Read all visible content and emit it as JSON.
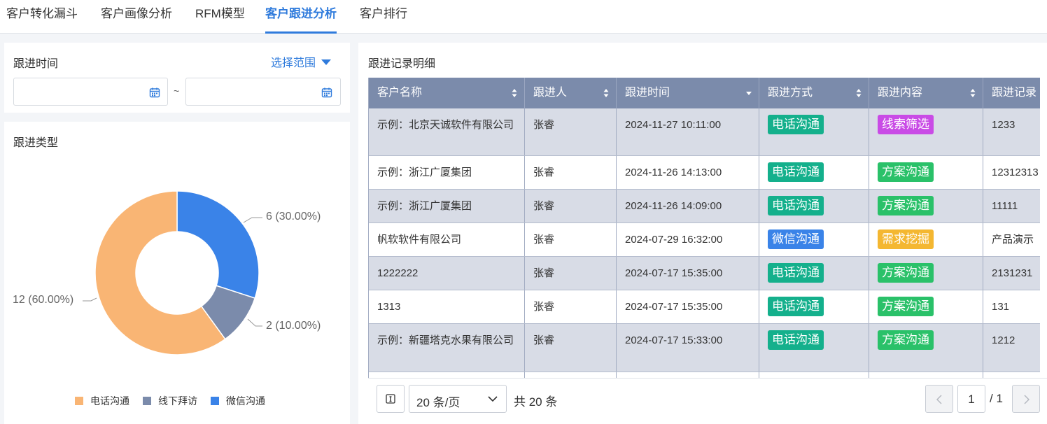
{
  "tabs": [
    {
      "label": "客户转化漏斗"
    },
    {
      "label": "客户画像分析"
    },
    {
      "label": "RFM模型"
    },
    {
      "label": "客户跟进分析"
    },
    {
      "label": "客户排行"
    }
  ],
  "filter": {
    "title": "跟进时间",
    "range_label": "选择范围",
    "start_value": "",
    "end_value": "",
    "separator": "~"
  },
  "type_chart": {
    "title": "跟进类型",
    "labels": {
      "phone": "12 (60.00%)",
      "offline": "2 (10.00%)",
      "wechat": "6 (30.00%)"
    },
    "legend": [
      "电话沟通",
      "线下拜访",
      "微信沟通"
    ]
  },
  "chart_data": {
    "type": "pie",
    "categories": [
      "电话沟通",
      "线下拜访",
      "微信沟通"
    ],
    "values": [
      12,
      2,
      6
    ],
    "percents": [
      60,
      10,
      30
    ],
    "colors": [
      "#f9b574",
      "#7b8bab",
      "#3a83e8"
    ],
    "donut": true,
    "legend_position": "bottom"
  },
  "records": {
    "title": "跟进记录明细",
    "columns": [
      "客户名称",
      "跟进人",
      "跟进时间",
      "跟进方式",
      "跟进内容",
      "跟进记录"
    ],
    "rows": [
      {
        "name": "示例：北京天诚软件有限公司",
        "owner": "张睿",
        "time": "2024-11-27 10:11:00",
        "method": "电话沟通",
        "content": "线索筛选",
        "note": "1233"
      },
      {
        "name": "示例：浙江广厦集团",
        "owner": "张睿",
        "time": "2024-11-26 14:13:00",
        "method": "电话沟通",
        "content": "方案沟通",
        "note": "12312313"
      },
      {
        "name": "示例：浙江广厦集团",
        "owner": "张睿",
        "time": "2024-11-26 14:09:00",
        "method": "电话沟通",
        "content": "方案沟通",
        "note": "11111"
      },
      {
        "name": "帆软软件有限公司",
        "owner": "张睿",
        "time": "2024-07-29 16:32:00",
        "method": "微信沟通",
        "content": "需求挖掘",
        "note": "产品演示"
      },
      {
        "name": "1222222",
        "owner": "张睿",
        "time": "2024-07-17 15:35:00",
        "method": "电话沟通",
        "content": "方案沟通",
        "note": "2131231"
      },
      {
        "name": "1313",
        "owner": "张睿",
        "time": "2024-07-17 15:35:00",
        "method": "电话沟通",
        "content": "方案沟通",
        "note": "131"
      },
      {
        "name": "示例：新疆塔克水果有限公司",
        "owner": "张睿",
        "time": "2024-07-17 15:33:00",
        "method": "电话沟通",
        "content": "方案沟通",
        "note": "1212"
      }
    ],
    "method_colors": {
      "电话沟通": "#14b08c",
      "微信沟通": "#3a83e8"
    },
    "content_colors": {
      "线索筛选": "#c94be6",
      "方案沟通": "#2ac169",
      "需求挖掘": "#f4b731"
    }
  },
  "pagination": {
    "page_size": "20 条/页",
    "total": "共 20 条",
    "current": "1",
    "total_pages": "/ 1"
  }
}
